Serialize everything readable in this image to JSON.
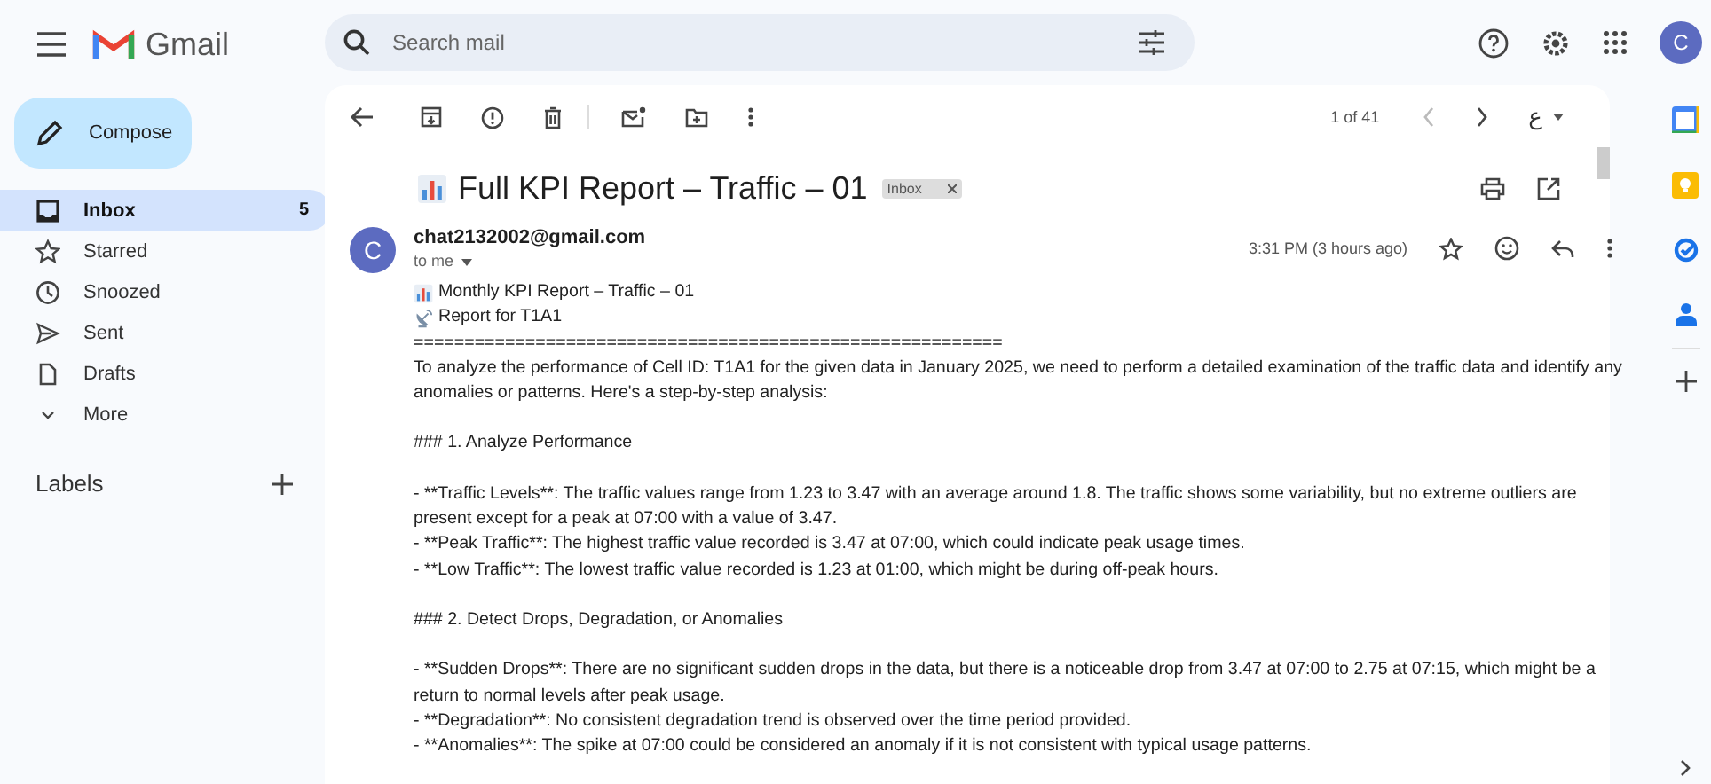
{
  "app": {
    "name": "Gmail",
    "avatar": "C"
  },
  "search": {
    "placeholder": "Search mail"
  },
  "compose": {
    "label": "Compose"
  },
  "sidebar": {
    "items": [
      {
        "kind": "inbox",
        "label": "Inbox",
        "count": "5",
        "selected": true
      },
      {
        "kind": "star",
        "label": "Starred",
        "selected": false
      },
      {
        "kind": "clock",
        "label": "Snoozed",
        "selected": false
      },
      {
        "kind": "send",
        "label": "Sent",
        "selected": false
      },
      {
        "kind": "file",
        "label": "Drafts",
        "selected": false
      },
      {
        "kind": "more",
        "label": "More",
        "selected": false
      }
    ],
    "labels_heading": "Labels"
  },
  "toolbar": {
    "pager": "1 of 41",
    "input_tool": "ع"
  },
  "message": {
    "sender_avatar": "C",
    "subject": "Full KPI Report – Traffic – 01",
    "label_chip": "Inbox",
    "sender": "chat2132002@gmail.com",
    "recipient": "to me",
    "time": "3:31 PM (3 hours ago)",
    "body": [
      {
        "kind": "chart-line",
        "text": "Monthly KPI Report – Traffic – 01"
      },
      {
        "kind": "antenna-line",
        "text": "Report for T1A1"
      },
      {
        "kind": "line",
        "text": "=========================================================="
      },
      {
        "kind": "line",
        "text": "To analyze the performance of Cell ID: T1A1 for the given data in January 2025, we need to perform a detailed examination of the traffic data and identify any anomalies or patterns. Here's a step-by-step analysis:"
      },
      {
        "kind": "gap"
      },
      {
        "kind": "line",
        "text": "### 1. Analyze Performance"
      },
      {
        "kind": "gap"
      },
      {
        "kind": "line",
        "text": "- **Traffic Levels**: The traffic values range from 1.23 to 3.47 with an average around 1.8. The traffic shows some variability, but no extreme outliers are present except for a peak at 07:00 with a value of 3.47."
      },
      {
        "kind": "line",
        "text": "- **Peak Traffic**: The highest traffic value recorded is 3.47 at 07:00, which could indicate peak usage times."
      },
      {
        "kind": "line",
        "text": "- **Low Traffic**: The lowest traffic value recorded is 1.23 at 01:00, which might be during off-peak hours."
      },
      {
        "kind": "gap"
      },
      {
        "kind": "line",
        "text": "### 2. Detect Drops, Degradation, or Anomalies"
      },
      {
        "kind": "gap"
      },
      {
        "kind": "line",
        "text": "- **Sudden Drops**: There are no significant sudden drops in the data, but there is a noticeable drop from 3.47 at 07:00 to 2.75 at 07:15, which might be a return to normal levels after peak usage."
      },
      {
        "kind": "line",
        "text": "- **Degradation**: No consistent degradation trend is observed over the time period provided."
      },
      {
        "kind": "line",
        "text": "- **Anomalies**: The spike at 07:00 could be considered an anomaly if it is not consistent with typical usage patterns."
      }
    ]
  }
}
